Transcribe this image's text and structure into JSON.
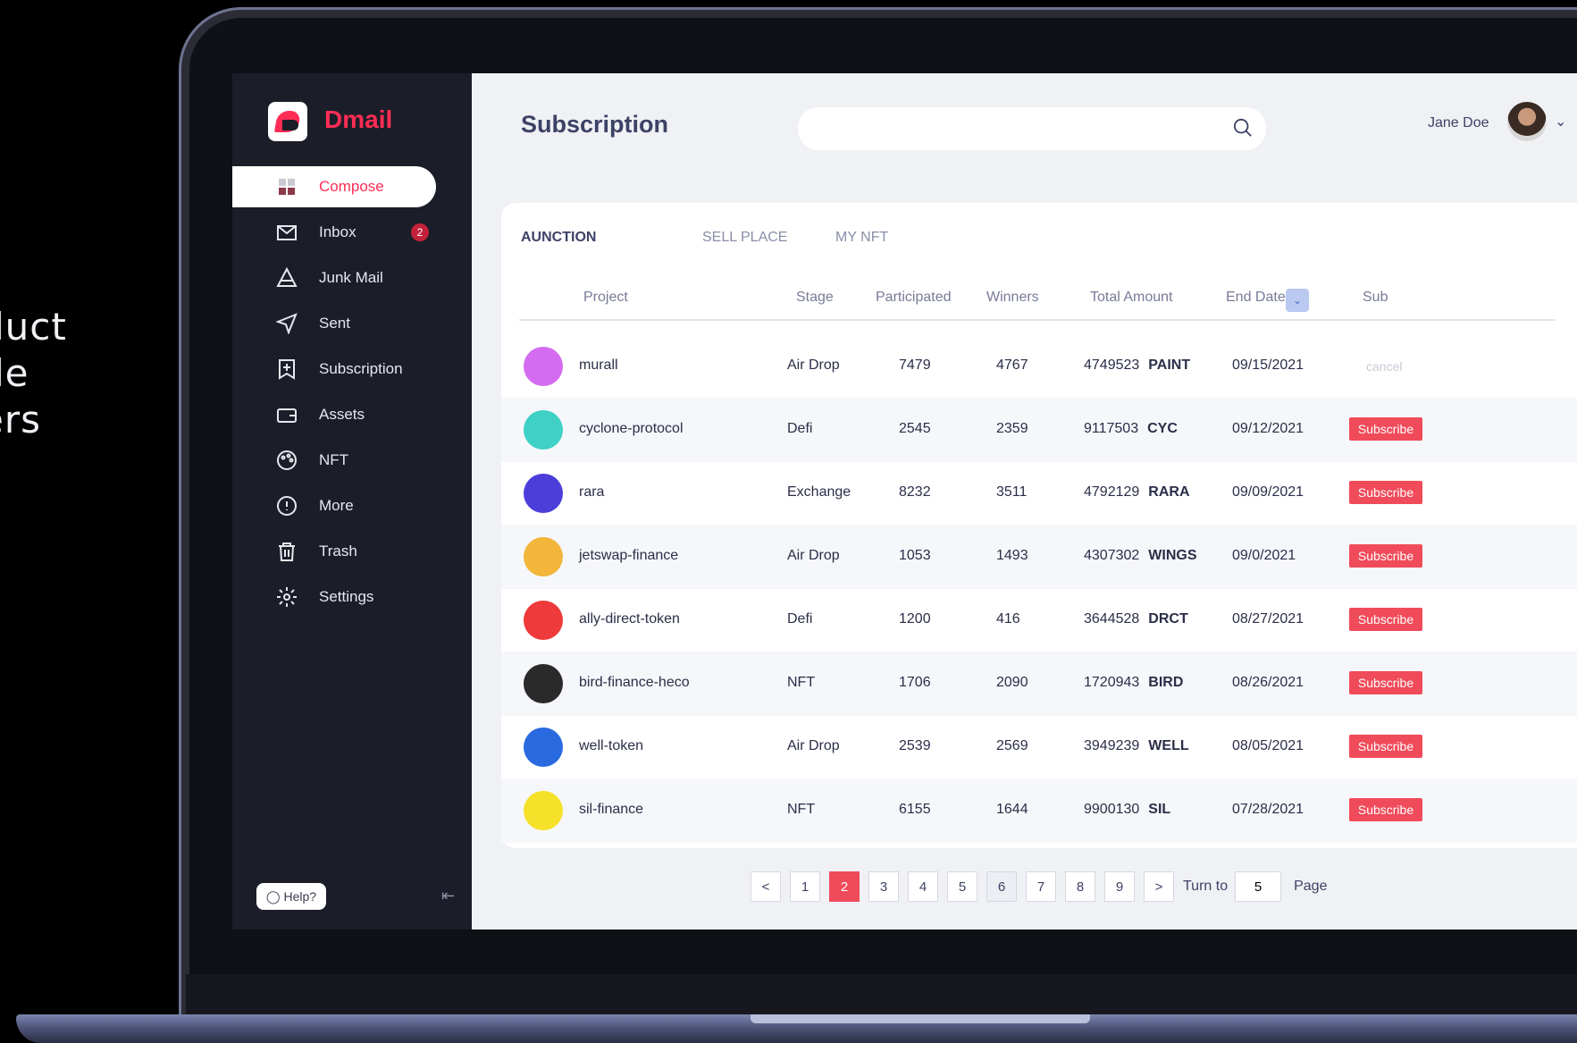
{
  "side_caption": [
    "duct",
    "de",
    "ers"
  ],
  "app": {
    "brand": "Dmail"
  },
  "sidebar": {
    "items": [
      {
        "label": "Compose",
        "icon": "compose-icon"
      },
      {
        "label": "Inbox",
        "icon": "inbox-icon",
        "badge": "2"
      },
      {
        "label": "Junk Mail",
        "icon": "junk-mail-icon"
      },
      {
        "label": "Sent",
        "icon": "sent-icon"
      },
      {
        "label": "Subscription",
        "icon": "subscription-icon"
      },
      {
        "label": "Assets",
        "icon": "wallet-icon"
      },
      {
        "label": "NFT",
        "icon": "palette-icon"
      },
      {
        "label": "More",
        "icon": "more-icon"
      },
      {
        "label": "Trash",
        "icon": "trash-icon"
      },
      {
        "label": "Settings",
        "icon": "gear-icon"
      }
    ],
    "help": "Help?"
  },
  "header": {
    "title": "Subscription",
    "search_placeholder": "",
    "user_name": "Jane Doe"
  },
  "tabs": [
    "AUNCTION",
    "SELL PLACE",
    "MY NFT"
  ],
  "columns": [
    "Project",
    "Stage",
    "Participated",
    "Winners",
    "Total Amount",
    "End Date",
    "Sub"
  ],
  "rows": [
    {
      "project": "murall",
      "stage": "Air Drop",
      "participated": "7479",
      "winners": "4767",
      "amount": "4749523",
      "ticker": "PAINT",
      "end": "09/15/2021",
      "sub": "cancel",
      "color": "#d36cf0"
    },
    {
      "project": "cyclone-protocol",
      "stage": "Defi",
      "participated": "2545",
      "winners": "2359",
      "amount": "9117503",
      "ticker": "CYC",
      "end": "09/12/2021",
      "sub": "Subscribe",
      "color": "#3fd1c6"
    },
    {
      "project": "rara",
      "stage": "Exchange",
      "participated": "8232",
      "winners": "3511",
      "amount": "4792129",
      "ticker": "RARA",
      "end": "09/09/2021",
      "sub": "Subscribe",
      "color": "#4b3ed9"
    },
    {
      "project": "jetswap-finance",
      "stage": "Air Drop",
      "participated": "1053",
      "winners": "1493",
      "amount": "4307302",
      "ticker": "WINGS",
      "end": "09/0/2021",
      "sub": "Subscribe",
      "color": "#f3b63a"
    },
    {
      "project": "ally-direct-token",
      "stage": "Defi",
      "participated": "1200",
      "winners": "416",
      "amount": "3644528",
      "ticker": "DRCT",
      "end": "08/27/2021",
      "sub": "Subscribe",
      "color": "#ee3a3a"
    },
    {
      "project": "bird-finance-heco",
      "stage": "NFT",
      "participated": "1706",
      "winners": "2090",
      "amount": "1720943",
      "ticker": "BIRD",
      "end": "08/26/2021",
      "sub": "Subscribe",
      "color": "#2a2a2a"
    },
    {
      "project": "well-token",
      "stage": "Air Drop",
      "participated": "2539",
      "winners": "2569",
      "amount": "3949239",
      "ticker": "WELL",
      "end": "08/05/2021",
      "sub": "Subscribe",
      "color": "#2a6ae0"
    },
    {
      "project": "sil-finance",
      "stage": "NFT",
      "participated": "6155",
      "winners": "1644",
      "amount": "9900130",
      "ticker": "SIL",
      "end": "07/28/2021",
      "sub": "Subscribe",
      "color": "#f5e12a"
    }
  ],
  "pagination": {
    "pages": [
      "1",
      "2",
      "3",
      "4",
      "5",
      "6",
      "7",
      "8",
      "9"
    ],
    "current": "2",
    "prev": "<",
    "next": ">",
    "turn_to": "Turn to",
    "turn_value": "5",
    "page_label": "Page"
  }
}
